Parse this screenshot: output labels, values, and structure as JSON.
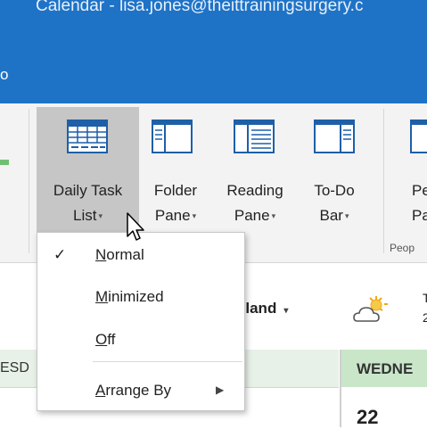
{
  "window": {
    "title": "Calendar - lisa.jones@theittrainingsurgery.c",
    "tab_fragment": "o"
  },
  "ribbon": {
    "buttons": [
      {
        "label_line1": "Daily Task",
        "label_line2": "List",
        "icon": "daily-task-list-icon",
        "selected": true
      },
      {
        "label_line1": "Folder",
        "label_line2": "Pane",
        "icon": "folder-pane-icon"
      },
      {
        "label_line1": "Reading",
        "label_line2": "Pane",
        "icon": "reading-pane-icon"
      },
      {
        "label_line1": "To-Do",
        "label_line2": "Bar",
        "icon": "todo-bar-icon"
      }
    ],
    "partial_button": {
      "line1": "Pe",
      "line2": "Pa"
    },
    "group_label": "Peop",
    "caret": "▾"
  },
  "dropdown": {
    "items": [
      {
        "label": "Normal",
        "accel": "N",
        "rest": "ormal",
        "checked": true,
        "check_glyph": "✓"
      },
      {
        "label": "Minimized",
        "accel": "M",
        "rest": "inimized"
      },
      {
        "label": "Off",
        "accel": "O",
        "rest": "ff"
      },
      {
        "label": "Arrange By",
        "accel": "A",
        "rest": "rrange By",
        "submenu_glyph": "▶"
      }
    ]
  },
  "calendar": {
    "location": "gland",
    "location_caret": "▾",
    "weather_icon": "partly-sunny-icon",
    "weather_line1": "T",
    "weather_line2": "2",
    "tue_header": "ESD",
    "wed_header": "WEDNE",
    "date_number": "22"
  },
  "colors": {
    "titlebar": "#1f73c6",
    "selected_button": "#c6c6c6",
    "day_header": "#c9e6c9"
  }
}
